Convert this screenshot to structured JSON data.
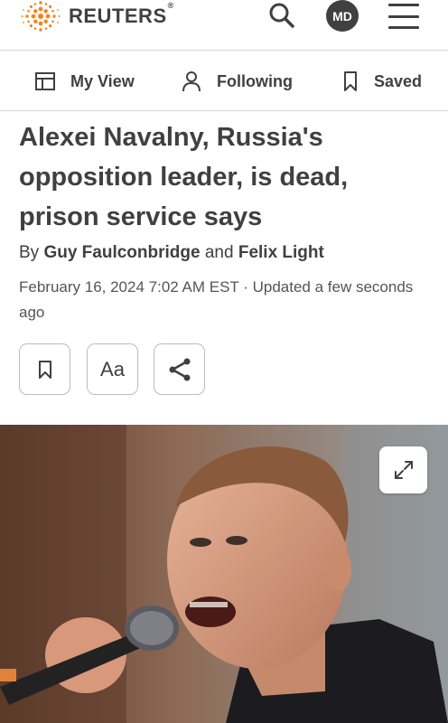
{
  "header": {
    "brand": "REUTERS",
    "brand_reg": "®",
    "avatar_initials": "MD",
    "icons": [
      "reuters-logo-icon",
      "search-icon",
      "menu-icon"
    ]
  },
  "tabs": [
    {
      "label": "My View",
      "icon": "layout-icon"
    },
    {
      "label": "Following",
      "icon": "person-icon"
    },
    {
      "label": "Saved",
      "icon": "bookmark-icon"
    }
  ],
  "article": {
    "headline": "Alexei Navalny, Russia's opposition leader, is dead, prison service says",
    "byline_prefix": "By ",
    "author1": "Guy Faulconbridge",
    "byline_and": " and ",
    "author2": "Felix Light",
    "dateline": "February 16, 2024 7:02 AM EST · Updated a few seconds ago",
    "text_size_label": "Aa"
  },
  "colors": {
    "brand_orange": "#f58220",
    "text": "#404040",
    "border": "#d6d6d6"
  }
}
